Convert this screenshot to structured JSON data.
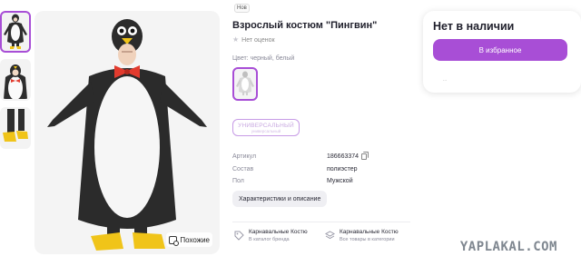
{
  "gallery": {
    "thumbnails": [
      "penguin-full",
      "penguin-closeup",
      "penguin-feet"
    ],
    "active_index": 0,
    "similar_label": "Похожие"
  },
  "product": {
    "tag": "Нов",
    "title": "Взрослый костюм \"Пингвин\"",
    "rating_text": "Нет оценок",
    "color_label": "Цвет: черный, белый",
    "size_label": "УНИВЕРСАЛЬНЫЙ",
    "size_sub": "универсальный",
    "specs": [
      {
        "key": "Артикул",
        "value": "186663374",
        "copyable": true
      },
      {
        "key": "Состав",
        "value": "полиэстер",
        "copyable": false
      },
      {
        "key": "Пол",
        "value": "Мужской",
        "copyable": false
      }
    ],
    "characteristics_button": "Характеристики и описание",
    "brand_links": [
      {
        "name": "Карнавальные Костю",
        "sub": "В каталог бренда",
        "icon": "tag-icon"
      },
      {
        "name": "Карнавальные Костю",
        "sub": "Все товары в категории",
        "icon": "layers-icon"
      }
    ]
  },
  "buy_card": {
    "stock_status": "Нет в наличии",
    "favorite_button": "В избранное",
    "footer_text": "..."
  },
  "watermark": "YAPLAKAL.COM",
  "colors": {
    "accent": "#a84ed6",
    "text": "#1f1f2b",
    "muted": "#8a8a99"
  }
}
